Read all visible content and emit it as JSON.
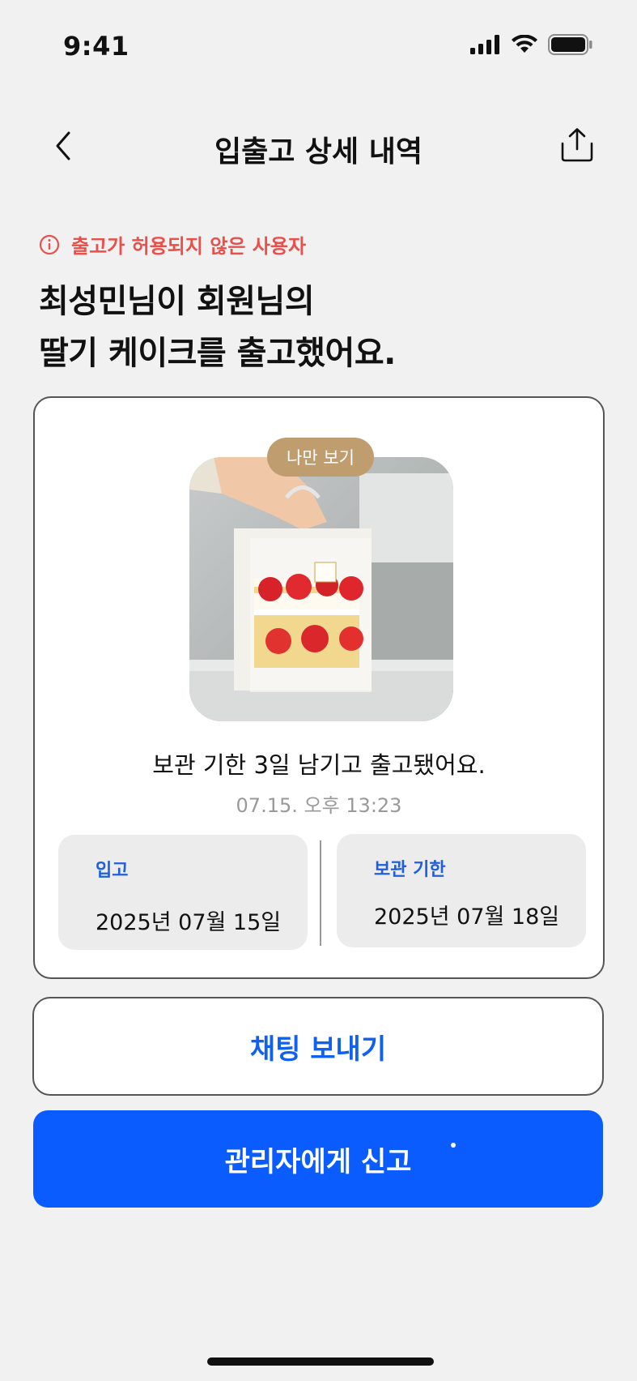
{
  "status_bar": {
    "time": "9:41"
  },
  "nav": {
    "title": "입출고 상세 내역"
  },
  "warning": {
    "text": "출고가 허용되지 않은 사용자"
  },
  "headline": {
    "line1": "최성민님이 회원님의",
    "line2": "딸기 케이크를 출고했어요."
  },
  "card": {
    "badge": "나만 보기",
    "message": "보관 기한 3일 남기고 출고됐어요.",
    "timestamp": "07.15. 오후 13:23",
    "in_label": "입고",
    "in_value": "2025년 07월 15일",
    "expiry_label": "보관 기한",
    "expiry_value": "2025년 07월 18일"
  },
  "buttons": {
    "chat": "채팅 보내기",
    "report": "관리자에게 신고"
  },
  "colors": {
    "warning": "#e8504b",
    "primary": "#0a5cff",
    "badge": "#c09d6e",
    "label_blue": "#1d5fe0"
  }
}
